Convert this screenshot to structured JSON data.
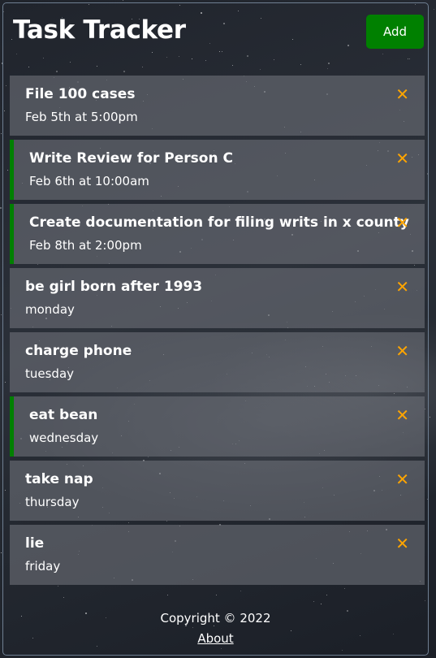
{
  "header": {
    "title": "Task Tracker",
    "add_label": "Add",
    "add_color": "#008000"
  },
  "tasks": [
    {
      "text": "File 100 cases",
      "day": "Feb 5th at 5:00pm",
      "reminder": false
    },
    {
      "text": "Write Review for Person C",
      "day": "Feb 6th at 10:00am",
      "reminder": true
    },
    {
      "text": "Create documentation for filing writs in x county",
      "day": "Feb 8th at 2:00pm",
      "reminder": true
    },
    {
      "text": "be girl born after 1993",
      "day": "monday",
      "reminder": false
    },
    {
      "text": "charge phone",
      "day": "tuesday",
      "reminder": false
    },
    {
      "text": "eat bean",
      "day": "wednesday",
      "reminder": true
    },
    {
      "text": "take nap",
      "day": "thursday",
      "reminder": false
    },
    {
      "text": "lie",
      "day": "friday",
      "reminder": false
    }
  ],
  "delete_icon": "close-icon",
  "colors": {
    "reminder_border": "#008000",
    "delete_icon": "#ffa500"
  },
  "footer": {
    "copyright": "Copyright © 2022",
    "about_link": "About"
  }
}
